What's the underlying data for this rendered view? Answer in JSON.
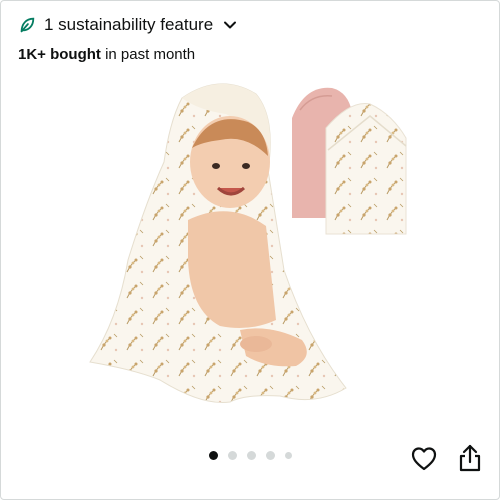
{
  "sustainability": {
    "label": "1 sustainability feature",
    "icon": "leaf-icon",
    "expand_icon": "chevron-down-icon",
    "color": "#067d62"
  },
  "purchase_stat": {
    "count": "1K+ bought",
    "suffix": "in past month"
  },
  "carousel": {
    "total": 5,
    "active_index": 0
  },
  "actions": {
    "favorite_icon": "heart-icon",
    "share_icon": "share-icon"
  },
  "colors": {
    "text": "#0f1111",
    "towel_pink": "#e8b4ad",
    "towel_cream": "#faf6ee",
    "floral_accent": "#c9a46b"
  }
}
